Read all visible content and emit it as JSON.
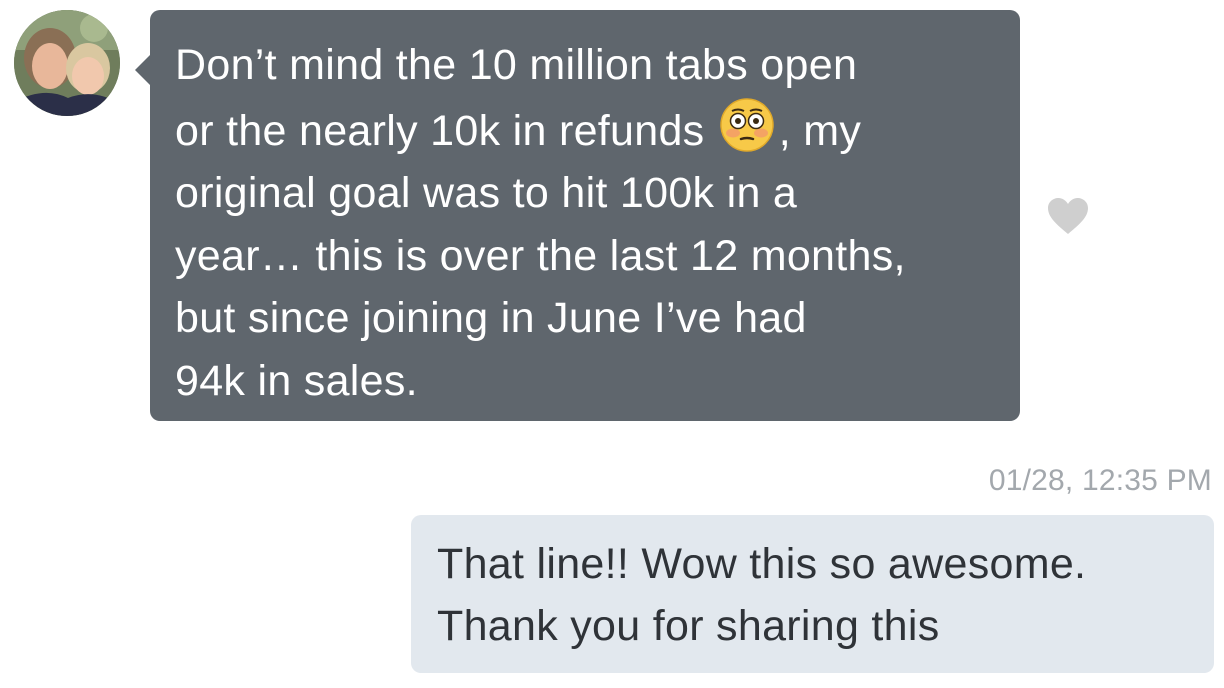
{
  "conversation": {
    "incoming": {
      "sender_avatar_icon": "avatar-photo-icon",
      "lines": [
        "Don’t mind the 10 million tabs open",
        "or the nearly 10k in refunds",
        ", my",
        "original goal was to hit 100k in a",
        "year… this is over the last 12 months,",
        "but since joining in June I’ve had",
        "94k in sales."
      ],
      "emoji_icon": "flushed-face-icon",
      "bubble_color": "#5f666d",
      "text_color": "#ffffff",
      "like_icon": "heart-icon",
      "like_color": "#cfcfcf"
    },
    "timestamp": "01/28, 12:35 PM",
    "outgoing": {
      "lines": [
        "That line!! Wow this so awesome.",
        "Thank you for sharing this"
      ],
      "bubble_color": "#e2e8ee",
      "text_color": "#2f3338"
    }
  }
}
